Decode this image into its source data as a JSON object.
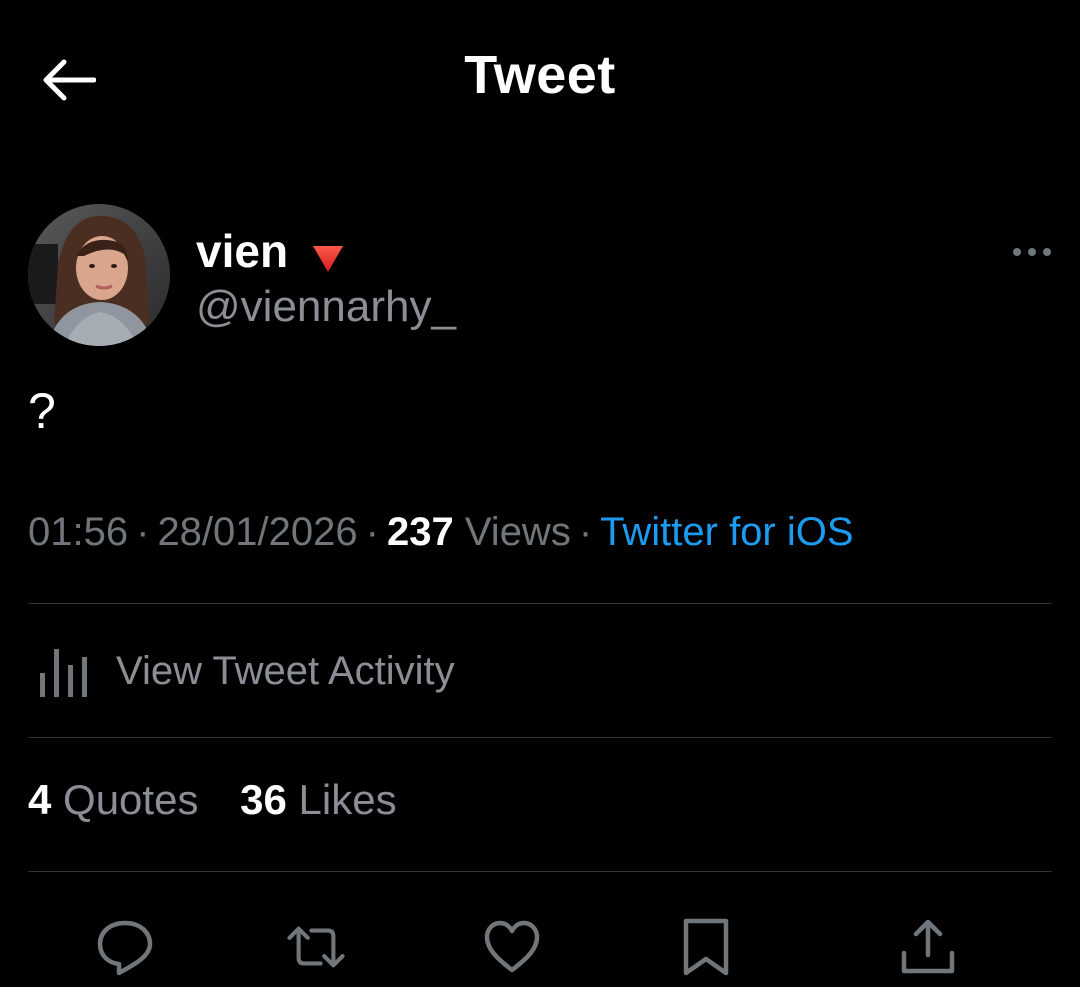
{
  "header": {
    "title": "Tweet",
    "back_icon": "arrow-left-icon"
  },
  "author": {
    "display_name": "vien",
    "badge_icon": "red-triangle-down-icon",
    "handle": "@viennarhy_"
  },
  "tweet": {
    "text": "?"
  },
  "meta": {
    "time": "01:56",
    "separator": "·",
    "date": "28/01/2026",
    "views_count": "237",
    "views_label": "Views",
    "source": "Twitter for iOS"
  },
  "activity": {
    "label": "View Tweet Activity",
    "icon": "bar-chart-icon"
  },
  "counts": {
    "quotes_count": "4",
    "quotes_label": "Quotes",
    "likes_count": "36",
    "likes_label": "Likes"
  },
  "actions": [
    {
      "name": "reply",
      "icon": "reply-icon"
    },
    {
      "name": "retweet",
      "icon": "retweet-icon"
    },
    {
      "name": "like",
      "icon": "heart-icon"
    },
    {
      "name": "bookmark",
      "icon": "bookmark-icon"
    },
    {
      "name": "share",
      "icon": "share-icon"
    }
  ],
  "colors": {
    "background": "#000000",
    "primary_text": "#ffffff",
    "secondary_text": "#71767b",
    "link": "#1d9bf0",
    "divider": "#2f3336",
    "badge": "#e0245e"
  }
}
